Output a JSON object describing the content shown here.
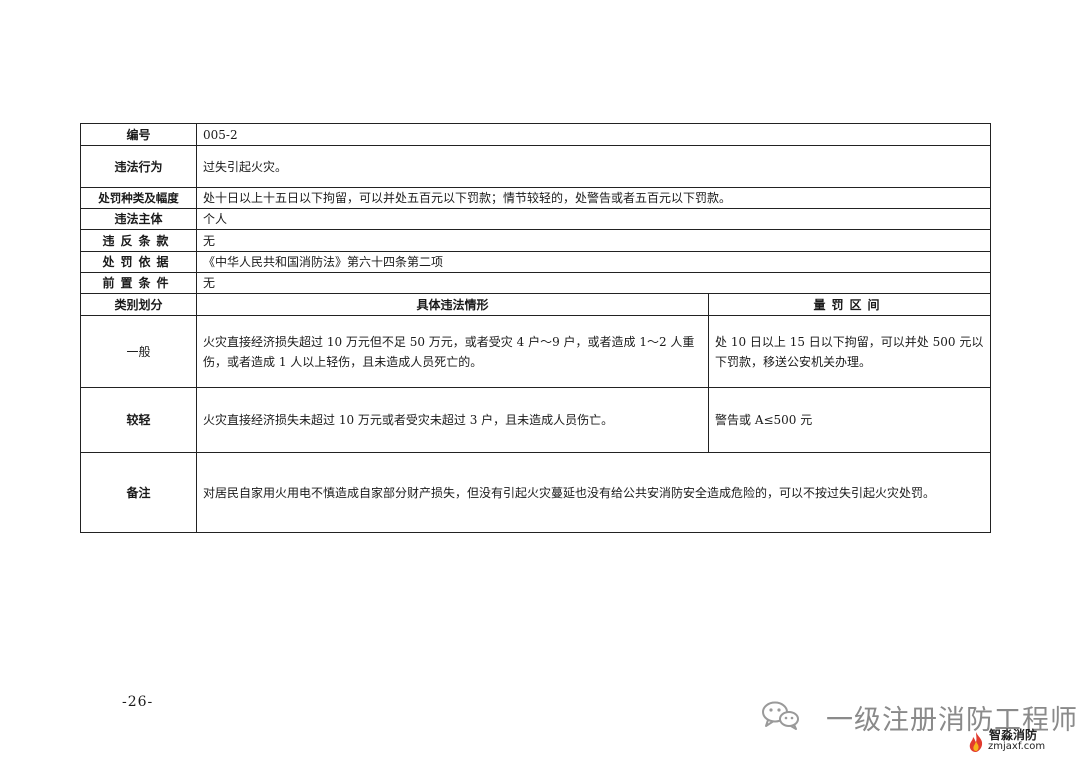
{
  "table": {
    "id_label": "编号",
    "id_value": "005-2",
    "behavior_label": "违法行为",
    "behavior_value": "过失引起火灾。",
    "penalty_label": "处罚种类及幅度",
    "penalty_value": "处十日以上十五日以下拘留，可以并处五百元以下罚款；情节较轻的，处警告或者五百元以下罚款。",
    "subject_label": "违法主体",
    "subject_value": "个人",
    "violated_label": "违反条款",
    "violated_value": "无",
    "basis_label": "处罚依据",
    "basis_value": "《中华人民共和国消防法》第六十四条第二项",
    "precondition_label": "前置条件",
    "precondition_value": "无",
    "col_category": "类别划分",
    "col_situation": "具体违法情形",
    "col_range": "量罚区间",
    "rows": [
      {
        "category": "一般",
        "situation": "火灾直接经济损失超过 10 万元但不足 50 万元，或者受灾 4 户～9 户，或者造成 1～2 人重伤，或者造成 1 人以上轻伤，且未造成人员死亡的。",
        "range": "处 10 日以上 15 日以下拘留，可以并处 500 元以下罚款，移送公安机关办理。"
      },
      {
        "category": "较轻",
        "situation": "火灾直接经济损失未超过 10 万元或者受灾未超过 3 户，且未造成人员伤亡。",
        "range": "警告或 A≤500 元"
      }
    ],
    "remark_label": "备注",
    "remark_value": "对居民自家用火用电不慎造成自家部分财产损失，但没有引起火灾蔓延也没有给公共安消防安全造成危险的，可以不按过失引起火灾处罚。"
  },
  "page_number": "-26-",
  "watermark": {
    "account_name": "一级注册消防工程师",
    "logo_name": "智淼消防",
    "logo_url": "zmjaxf.com",
    "icon": "wechat-icon"
  }
}
